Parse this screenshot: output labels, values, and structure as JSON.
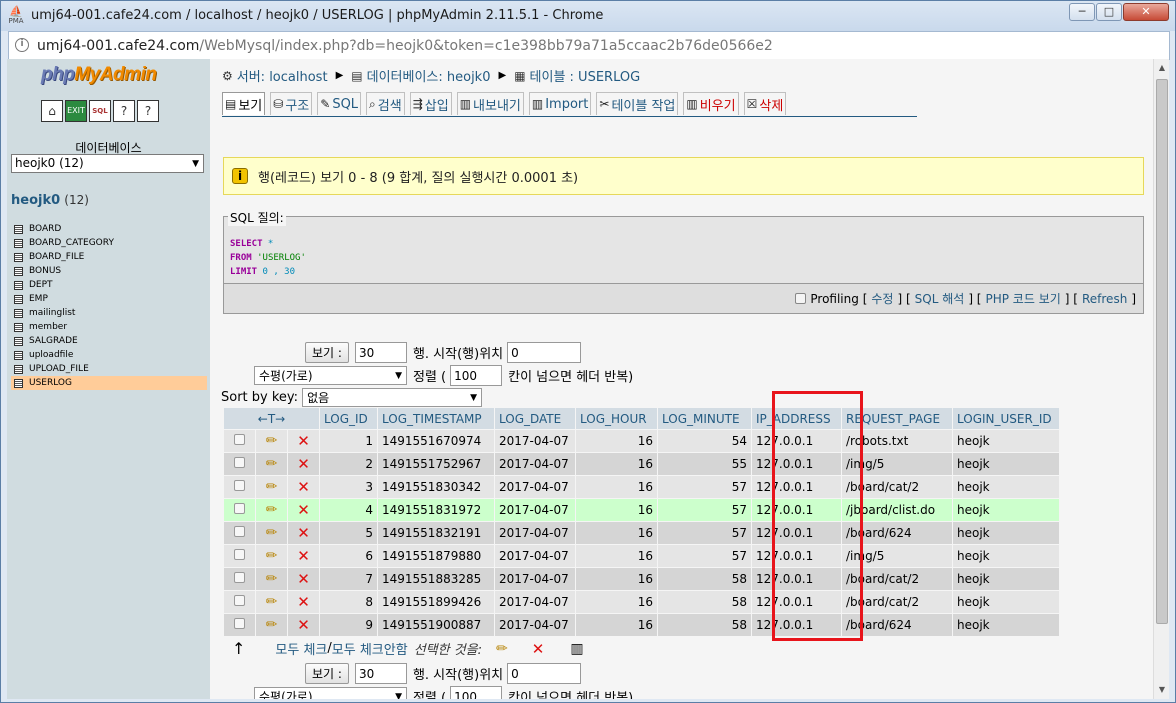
{
  "window": {
    "title": "umj64-001.cafe24.com / localhost / heojk0 / USERLOG | phpMyAdmin 2.11.5.1 - Chrome",
    "url_host": "umj64-001.cafe24.com",
    "url_path": "/WebMysql/index.php?db=heojk0&token=c1e398bb79a71a5ccaac2b76de0566e2",
    "favicon_text": "PMA",
    "btn_min": "─",
    "btn_max": "□",
    "btn_close": "✕"
  },
  "sidebar": {
    "logo_php": "php",
    "logo_myadmin": "MyAdmin",
    "db_label": "데이터베이스",
    "db_selected": "heojk0 (12)",
    "db_name": "heojk0",
    "db_count": "(12)",
    "tables": [
      {
        "name": "BOARD"
      },
      {
        "name": "BOARD_CATEGORY"
      },
      {
        "name": "BOARD_FILE"
      },
      {
        "name": "BONUS"
      },
      {
        "name": "DEPT"
      },
      {
        "name": "EMP"
      },
      {
        "name": "mailinglist"
      },
      {
        "name": "member"
      },
      {
        "name": "SALGRADE"
      },
      {
        "name": "uploadfile"
      },
      {
        "name": "UPLOAD_FILE"
      },
      {
        "name": "USERLOG"
      }
    ]
  },
  "breadcrumb": {
    "server": "서버: localhost",
    "database": "데이터베이스: heojk0",
    "table": "테이블 : USERLOG"
  },
  "tabs": [
    {
      "label": "보기",
      "icon": "browse-icon"
    },
    {
      "label": "구조",
      "icon": "structure-icon"
    },
    {
      "label": "SQL",
      "icon": "sql-icon"
    },
    {
      "label": "검색",
      "icon": "search-icon"
    },
    {
      "label": "삽입",
      "icon": "insert-icon"
    },
    {
      "label": "내보내기",
      "icon": "export-icon"
    },
    {
      "label": "Import",
      "icon": "import-icon"
    },
    {
      "label": "테이블 작업",
      "icon": "operations-icon"
    },
    {
      "label": "비우기",
      "icon": "empty-icon"
    },
    {
      "label": "삭제",
      "icon": "drop-icon"
    }
  ],
  "notice": {
    "text": "행(레코드) 보기 0 - 8 (9 합계, 질의 실행시간 0.0001 초)"
  },
  "sql": {
    "legend": "SQL 질의:",
    "select": "SELECT",
    "star": " *",
    "from": "FROM",
    "table": " 'USERLOG'",
    "limit": "LIMIT",
    "limit_vals": " 0 , 30",
    "profiling": "Profiling",
    "edit": "수정",
    "explain": "SQL 해석",
    "php": "PHP 코드 보기",
    "refresh": "Refresh"
  },
  "nav": {
    "show_btn": "보기 :",
    "rows": "30",
    "rows_label": "행. 시작(행)위치",
    "start": "0",
    "mode": "수평(가로)",
    "sort_label": "정렬 (",
    "repeat": "100",
    "repeat_label": "칸이 넘으면 헤더 반복)",
    "sort_by_key": "Sort by key:",
    "sort_key_value": "없음",
    "bottom_mode_label": "정렬 (",
    "bottom_repeat_label": "칸이 넘으면 헤더 반복)"
  },
  "table": {
    "arrows": "←T→",
    "columns": [
      "LOG_ID",
      "LOG_TIMESTAMP",
      "LOG_DATE",
      "LOG_HOUR",
      "LOG_MINUTE",
      "IP_ADDRESS",
      "REQUEST_PAGE",
      "LOGIN_USER_ID"
    ],
    "rows": [
      {
        "id": "1",
        "ts": "1491551670974",
        "date": "2017-04-07",
        "hour": "16",
        "minute": "54",
        "ip": "127.0.0.1",
        "page": "/robots.txt",
        "user": "heojk"
      },
      {
        "id": "2",
        "ts": "1491551752967",
        "date": "2017-04-07",
        "hour": "16",
        "minute": "55",
        "ip": "127.0.0.1",
        "page": "/img/5",
        "user": "heojk"
      },
      {
        "id": "3",
        "ts": "1491551830342",
        "date": "2017-04-07",
        "hour": "16",
        "minute": "57",
        "ip": "127.0.0.1",
        "page": "/board/cat/2",
        "user": "heojk"
      },
      {
        "id": "4",
        "ts": "1491551831972",
        "date": "2017-04-07",
        "hour": "16",
        "minute": "57",
        "ip": "127.0.0.1",
        "page": "/jboard/clist.do",
        "user": "heojk"
      },
      {
        "id": "5",
        "ts": "1491551832191",
        "date": "2017-04-07",
        "hour": "16",
        "minute": "57",
        "ip": "127.0.0.1",
        "page": "/board/624",
        "user": "heojk"
      },
      {
        "id": "6",
        "ts": "1491551879880",
        "date": "2017-04-07",
        "hour": "16",
        "minute": "57",
        "ip": "127.0.0.1",
        "page": "/img/5",
        "user": "heojk"
      },
      {
        "id": "7",
        "ts": "1491551883285",
        "date": "2017-04-07",
        "hour": "16",
        "minute": "58",
        "ip": "127.0.0.1",
        "page": "/board/cat/2",
        "user": "heojk"
      },
      {
        "id": "8",
        "ts": "1491551899426",
        "date": "2017-04-07",
        "hour": "16",
        "minute": "58",
        "ip": "127.0.0.1",
        "page": "/board/cat/2",
        "user": "heojk"
      },
      {
        "id": "9",
        "ts": "1491551900887",
        "date": "2017-04-07",
        "hour": "16",
        "minute": "58",
        "ip": "127.0.0.1",
        "page": "/board/624",
        "user": "heojk"
      }
    ]
  },
  "bulk": {
    "check_all": "모두 체크",
    "separator": " / ",
    "uncheck_all": "모두 체크안함",
    "with_selected": "선택한 것을:"
  },
  "colors": {
    "link": "#235a81",
    "highlight_border": "#e8141b",
    "row_highlight": "#ccffcc"
  }
}
